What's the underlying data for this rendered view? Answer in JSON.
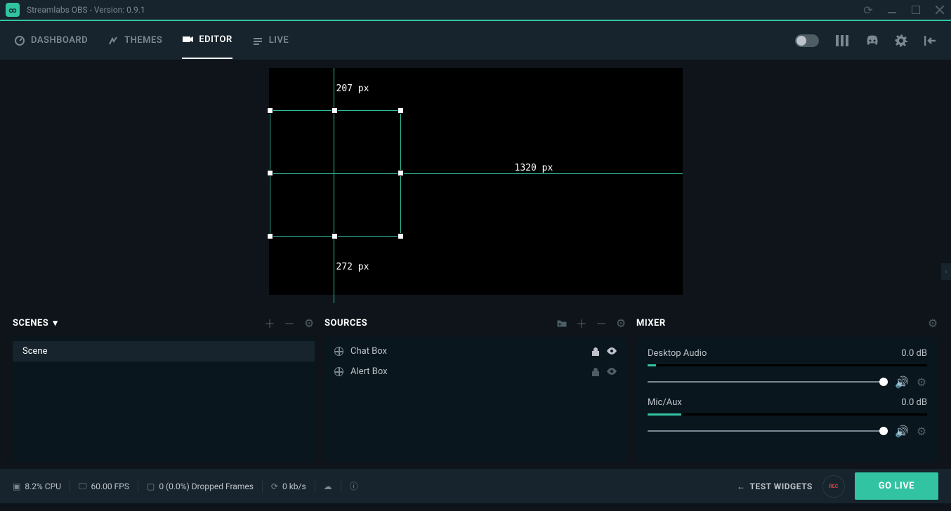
{
  "titlebar": {
    "title": "Streamlabs OBS - Version: 0.9.1"
  },
  "nav": {
    "dashboard": "DASHBOARD",
    "themes": "THEMES",
    "editor": "EDITOR",
    "live": "LIVE"
  },
  "preview": {
    "top_guide": "207 px",
    "bottom_guide": "272 px",
    "right_guide": "1320 px"
  },
  "scenes": {
    "title": "SCENES",
    "items": [
      {
        "name": "Scene"
      }
    ]
  },
  "sources": {
    "title": "SOURCES",
    "items": [
      {
        "name": "Chat Box",
        "visible": true
      },
      {
        "name": "Alert Box",
        "visible": false
      }
    ]
  },
  "mixer": {
    "title": "MIXER",
    "channels": [
      {
        "name": "Desktop Audio",
        "level": "0.0 dB"
      },
      {
        "name": "Mic/Aux",
        "level": "0.0 dB"
      }
    ]
  },
  "footer": {
    "cpu": "8.2% CPU",
    "fps": "60.00 FPS",
    "dropped": "0 (0.0%) Dropped Frames",
    "bitrate": "0 kb/s",
    "test_widgets": "TEST WIDGETS",
    "rec": "REC",
    "go_live": "GO LIVE"
  }
}
